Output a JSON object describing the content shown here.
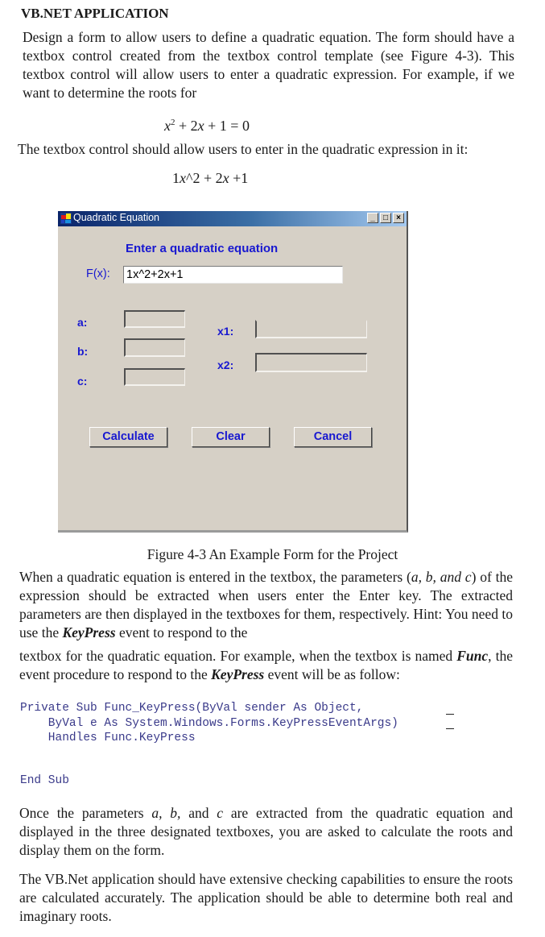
{
  "heading": "VB.NET APPLICATION",
  "intro_paragraph": "Design a form to allow users to define a quadratic equation.  The form should have a textbox control created from the textbox control template (see Figure 4-3). This textbox control will allow users to enter a quadratic expression. For example, if we want to determine the roots for",
  "equation_display": {
    "x": "x",
    "sup": "2",
    "rest": " + 2",
    "x2": "x",
    "tail": " + 1 = 0"
  },
  "entry_paragraph": "The textbox control should allow users to enter in the quadratic expression in it:",
  "equation_entry": {
    "lead": "1",
    "x": "x",
    "mid": "^2 + 2",
    "x2": "x",
    "tail": " +1"
  },
  "form": {
    "title": "Quadratic Equation",
    "window_buttons": {
      "minimize": "_",
      "maximize": "□",
      "close": "×"
    },
    "prompt": "Enter a quadratic equation",
    "fx_label": "F(x):",
    "fx_value": "1x^2+2x+1",
    "param_labels": {
      "a": "a:",
      "b": "b:",
      "c": "c:"
    },
    "param_values": {
      "a": "",
      "b": "",
      "c": ""
    },
    "root_labels": {
      "x1": "x1:",
      "x2": "x2:"
    },
    "root_values": {
      "x1": "",
      "x2": ""
    },
    "buttons": {
      "calculate": "Calculate",
      "clear": "Clear",
      "cancel": "Cancel"
    },
    "colors": {
      "label_blue": "#1818d0",
      "form_bg": "#d6d0c6",
      "title_dark": "#0a246a",
      "title_light": "#a6caf0"
    }
  },
  "caption": "Figure 4-3 An Example Form for the Project",
  "para3": {
    "t1": "When a quadratic equation is entered in the textbox, the parameters (",
    "i1": "a, b, and c",
    "t2": ") of the expression should be extracted when users enter the Enter key.  The extracted parameters are then displayed in the textboxes for them, respectively.  Hint: You need to use the ",
    "bi1": "KeyPress",
    "t3": " event to respond to the"
  },
  "para4": {
    "t1": "textbox for the quadratic equation. For example, when the textbox is named ",
    "bi1": "Func",
    "t2": ", the event procedure to respond to the ",
    "bi2": "KeyPress",
    "t3": " event will be as follow:"
  },
  "code": {
    "lines": [
      "Private Sub Func_KeyPress(ByVal sender As Object,",
      "    ByVal e As System.Windows.Forms.KeyPressEventArgs)",
      "    Handles Func.KeyPress"
    ],
    "end": "End Sub"
  },
  "para5": {
    "t1": "Once the parameters ",
    "i1": "a, b,",
    "t2": " and ",
    "i2": "c",
    "t3": " are extracted from the quadratic equation and displayed in the three designated textboxes, you are asked to calculate the roots and display them on the form."
  },
  "para6": "The VB.Net application should have extensive checking capabilities to ensure the roots are calculated accurately. The application should be able to determine both real and imaginary roots."
}
